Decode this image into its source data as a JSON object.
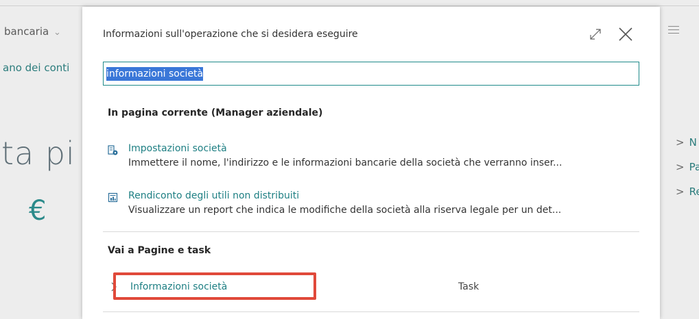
{
  "background": {
    "left_menu_label": "bancaria",
    "left_link": "ano dei conti",
    "big_text": "ta pi",
    "currency_symbol": "€",
    "right_links": [
      "N",
      "Pa",
      "Re"
    ]
  },
  "dialog": {
    "title": "Informazioni sull'operazione che si desidera eseguire",
    "search": {
      "value": "informazioni società"
    },
    "sections": [
      {
        "heading": "In pagina corrente (Manager aziendale)",
        "items": [
          {
            "icon": "company-settings-icon",
            "title": "Impostazioni società",
            "description": "Immettere il nome, l'indirizzo e le informazioni bancarie della società che verranno inser..."
          },
          {
            "icon": "report-icon",
            "title": "Rendiconto degli utili non distribuiti",
            "description": "Visualizzare un report che indica le modifiche della società alla riserva legale per un det..."
          }
        ]
      },
      {
        "heading": "Vai a Pagine e task",
        "items": [
          {
            "title": "Informazioni società",
            "type": "Task"
          }
        ]
      }
    ]
  },
  "colors": {
    "accent": "#1e7f83",
    "selection": "#3a77d8",
    "highlight_border": "#e0493a"
  }
}
